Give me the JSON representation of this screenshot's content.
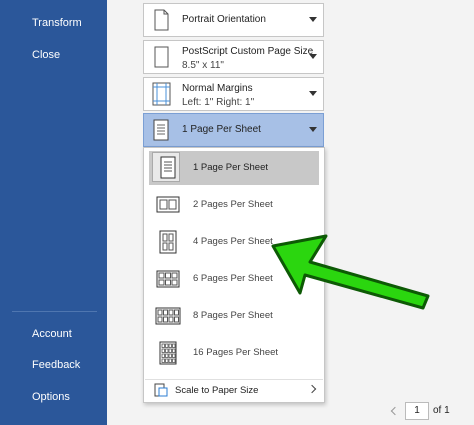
{
  "sidebar": {
    "top_items": [
      "Transform",
      "Close"
    ],
    "bottom_items": [
      "Account",
      "Feedback",
      "Options"
    ]
  },
  "settings": {
    "orientation": {
      "label": "Portrait Orientation"
    },
    "paper": {
      "label": "PostScript Custom Page Size",
      "detail": "8.5\" x 11\""
    },
    "margins": {
      "label": "Normal Margins",
      "detail": "Left:  1\"    Right:  1\""
    },
    "pages_per_sheet": {
      "label": "1 Page Per Sheet"
    }
  },
  "dropdown": {
    "items": [
      {
        "label": "1 Page Per Sheet",
        "active": true
      },
      {
        "label": "2 Pages Per Sheet"
      },
      {
        "label": "4 Pages Per Sheet"
      },
      {
        "label": "6 Pages Per Sheet"
      },
      {
        "label": "8 Pages Per Sheet"
      },
      {
        "label": "16 Pages Per Sheet"
      }
    ],
    "scale_label": "Scale to Paper Size"
  },
  "pager": {
    "current": "1",
    "total_label": "of 1"
  },
  "colors": {
    "sidebar": "#2b579a",
    "selected": "#a7c0e6",
    "arrow": "#22cc11"
  }
}
